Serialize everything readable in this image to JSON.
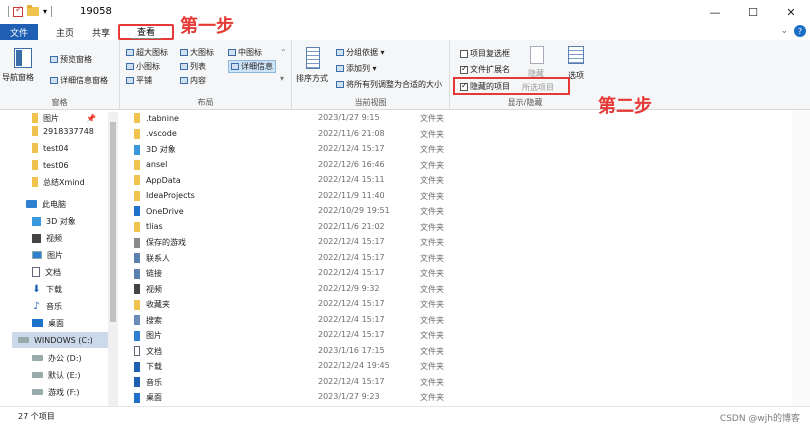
{
  "window": {
    "title": "19058",
    "buttons": {
      "minimize": "—",
      "maximize": "☐",
      "close": "✕"
    }
  },
  "tabs": {
    "file": "文件",
    "home": "主页",
    "share": "共享",
    "view": "查看"
  },
  "annotations": {
    "step1": "第一步",
    "step2": "第二步"
  },
  "ribbon": {
    "pane_group": {
      "nav_pane": "导航窗格",
      "preview_pane": "预览窗格",
      "details_pane": "详细信息窗格",
      "label": "窗格"
    },
    "layout_group": {
      "items": [
        "超大图标",
        "大图标",
        "中图标",
        "小图标",
        "列表",
        "详细信息",
        "平铺",
        "内容"
      ],
      "label": "布局"
    },
    "current_view_group": {
      "sort_by": "排序方式",
      "group_by": "分组依据 ▾",
      "add_column": "添加列 ▾",
      "fit_columns": "将所有列调整为合适的大小",
      "label": "当前视图"
    },
    "show_hide_group": {
      "item_checkboxes": "项目复选框",
      "file_extensions": "文件扩展名",
      "hidden_items": "隐藏的项目",
      "hide_selected": "隐藏",
      "selected_items": "所选项目",
      "options": "选项",
      "label": "显示/隐藏"
    }
  },
  "sidebar": {
    "items": [
      {
        "label": "图片",
        "icon": "folder-icon"
      },
      {
        "label": "2918337748",
        "icon": "folder-icon"
      },
      {
        "label": "test04",
        "icon": "folder-icon"
      },
      {
        "label": "test06",
        "icon": "folder-icon"
      },
      {
        "label": "总结Xmind",
        "icon": "folder-icon"
      },
      {
        "label": "此电脑",
        "icon": "computer-icon"
      },
      {
        "label": "3D 对象",
        "icon": "cube-icon"
      },
      {
        "label": "视频",
        "icon": "video-icon"
      },
      {
        "label": "图片",
        "icon": "picture-icon"
      },
      {
        "label": "文档",
        "icon": "document-icon"
      },
      {
        "label": "下载",
        "icon": "download-icon"
      },
      {
        "label": "音乐",
        "icon": "music-icon"
      },
      {
        "label": "桌面",
        "icon": "desktop-icon"
      },
      {
        "label": "WINDOWS (C:)",
        "icon": "drive-icon"
      },
      {
        "label": "办公 (D:)",
        "icon": "drive-icon"
      },
      {
        "label": "默认 (E:)",
        "icon": "drive-icon"
      },
      {
        "label": "游戏 (F:)",
        "icon": "drive-icon"
      }
    ]
  },
  "files": [
    {
      "name": ".tabnine",
      "date": "2023/1/27 9:15",
      "type": "文件夹"
    },
    {
      "name": ".vscode",
      "date": "2022/11/6 21:08",
      "type": "文件夹"
    },
    {
      "name": "3D 对象",
      "date": "2022/12/4 15:17",
      "type": "文件夹"
    },
    {
      "name": "ansel",
      "date": "2022/12/6 16:46",
      "type": "文件夹"
    },
    {
      "name": "AppData",
      "date": "2022/12/4 15:11",
      "type": "文件夹"
    },
    {
      "name": "IdeaProjects",
      "date": "2022/11/9 11:40",
      "type": "文件夹"
    },
    {
      "name": "OneDrive",
      "date": "2022/10/29 19:51",
      "type": "文件夹"
    },
    {
      "name": "tlias",
      "date": "2022/11/6 21:02",
      "type": "文件夹"
    },
    {
      "name": "保存的游戏",
      "date": "2022/12/4 15:17",
      "type": "文件夹"
    },
    {
      "name": "联系人",
      "date": "2022/12/4 15:17",
      "type": "文件夹"
    },
    {
      "name": "链接",
      "date": "2022/12/4 15:17",
      "type": "文件夹"
    },
    {
      "name": "视频",
      "date": "2022/12/9 9:32",
      "type": "文件夹"
    },
    {
      "name": "收藏夹",
      "date": "2022/12/4 15:17",
      "type": "文件夹"
    },
    {
      "name": "搜索",
      "date": "2022/12/4 15:17",
      "type": "文件夹"
    },
    {
      "name": "图片",
      "date": "2022/12/4 15:17",
      "type": "文件夹"
    },
    {
      "name": "文档",
      "date": "2023/1/16 17:15",
      "type": "文件夹"
    },
    {
      "name": "下载",
      "date": "2022/12/24 19:45",
      "type": "文件夹"
    },
    {
      "name": "音乐",
      "date": "2022/12/4 15:17",
      "type": "文件夹"
    },
    {
      "name": "桌面",
      "date": "2023/1/27 9:23",
      "type": "文件夹"
    }
  ],
  "status": {
    "count": "27 个项目"
  },
  "watermark": "CSDN @wjh的博客"
}
